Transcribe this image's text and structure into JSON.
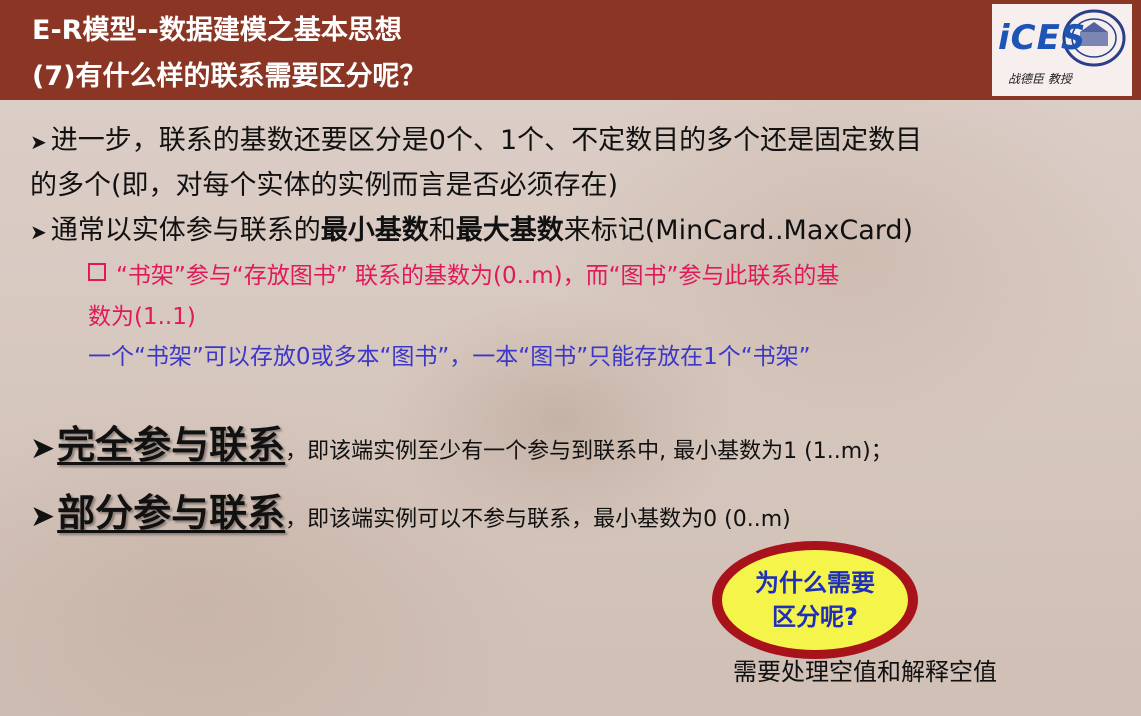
{
  "header": {
    "title_line1": "E-R模型--数据建模之基本思想",
    "title_line2": "(7)有什么样的联系需要区分呢？",
    "logo_text": "iCES",
    "logo_caption": "战德臣 教授"
  },
  "bullets": {
    "b1_line1": "进一步，联系的基数还要区分是0个、1个、不定数目的多个还是固定数目",
    "b1_line2": "的多个(即，对每个实体的实例而言是否必须存在)",
    "b2_part1": "通常以实体参与联系的",
    "b2_strong1": "最小基数",
    "b2_part2": "和",
    "b2_strong2": "最大基数",
    "b2_part3": "来标记(MinCard..MaxCard)",
    "example_line1": "“书架”参与“存放图书” 联系的基数为(0..m)，而“图书”参与此联系的基",
    "example_line2": "数为(1..1)",
    "example_line3": "一个“书架”可以存放0或多本“图书”，一本“图书”只能存放在1个“书架”"
  },
  "terms": {
    "total_title": "完全参与联系",
    "total_desc": "，即该端实例至少有一个参与到联系中, 最小基数为1 (1..m)；",
    "partial_title": "部分参与联系",
    "partial_desc": "，即该端实例可以不参与联系，最小基数为0 (0..m)"
  },
  "callout": {
    "question_line1": "为什么需要",
    "question_line2": "区分呢?",
    "answer": "需要处理空值和解释空值"
  },
  "colors": {
    "header_bg": "#8b3524",
    "example_pink": "#e0195a",
    "example_blue": "#3c37c8",
    "oval_ring": "#a8131b",
    "oval_fill": "#f4f44a"
  }
}
